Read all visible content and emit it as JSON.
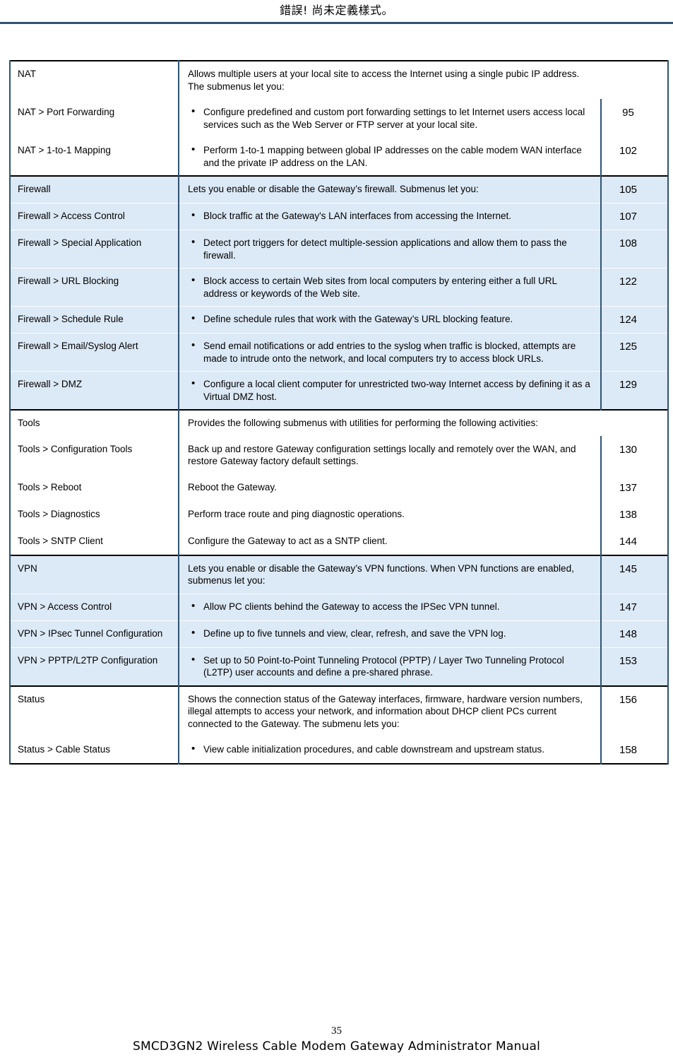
{
  "header": {
    "title": "錯誤! 尚未定義樣式。",
    "rule_color": "#2e5374"
  },
  "footer": {
    "page_number": "35",
    "manual_title": "SMCD3GN2 Wireless Cable Modem Gateway Administrator Manual"
  },
  "table": {
    "shade_color": "#dce9f6",
    "border_color": "#2e5374",
    "sections": [
      {
        "id": "nat",
        "shaded": false,
        "rows": [
          {
            "menu": "NAT",
            "desc": "Allows multiple users at your local site to access the Internet using a single pubic IP address. The submenus let you:",
            "page": "",
            "bullet": false,
            "page_ruled": false
          },
          {
            "menu": "NAT > Port Forwarding",
            "desc": "Configure predefined and custom port forwarding settings to let Internet users access local services such as the Web Server or FTP server at your local site.",
            "page": "95",
            "bullet": true,
            "page_ruled": true
          },
          {
            "menu": "NAT > 1-to-1 Mapping",
            "desc": "Perform 1-to-1 mapping between global IP addresses on the cable modem WAN interface and the private IP address on the LAN.",
            "page": "102",
            "bullet": true,
            "page_ruled": true
          }
        ]
      },
      {
        "id": "firewall",
        "shaded": true,
        "rows": [
          {
            "menu": "Firewall",
            "desc": "Lets you enable or disable the Gateway’s firewall. Submenus let you:",
            "page": "105",
            "bullet": false,
            "page_ruled": true
          },
          {
            "menu": "Firewall > Access Control",
            "desc": "Block traffic at the Gateway's LAN interfaces from accessing the Internet.",
            "page": "107",
            "bullet": true,
            "page_ruled": true
          },
          {
            "menu": "Firewall > Special Application",
            "desc": "Detect port triggers for detect multiple-session applications and allow them to pass the firewall.",
            "page": "108",
            "bullet": true,
            "page_ruled": true
          },
          {
            "menu": "Firewall > URL Blocking",
            "desc": "Block access to certain Web sites from local computers by entering either a full URL address or keywords of the Web site.",
            "page": "122",
            "bullet": true,
            "page_ruled": true
          },
          {
            "menu": "Firewall > Schedule Rule",
            "desc": "Define schedule rules that work with the Gateway’s URL blocking feature.",
            "page": "124",
            "bullet": true,
            "page_ruled": true
          },
          {
            "menu": "Firewall > Email/Syslog Alert",
            "desc": "Send email notifications or add entries to the syslog when traffic is blocked, attempts are made to intrude onto the network, and local computers try to access block URLs.",
            "page": "125",
            "bullet": true,
            "page_ruled": true
          },
          {
            "menu": "Firewall > DMZ",
            "desc": "Configure a local client computer for unrestricted two-way Internet access by defining it as a Virtual DMZ host.",
            "page": "129",
            "bullet": true,
            "page_ruled": true
          }
        ]
      },
      {
        "id": "tools",
        "shaded": false,
        "rows": [
          {
            "menu": "Tools",
            "desc": "Provides the following submenus with utilities for performing the following activities:",
            "page": "",
            "bullet": false,
            "page_ruled": false
          },
          {
            "menu": "Tools > Configuration Tools",
            "desc": "Back up and restore Gateway configuration settings locally and remotely over the WAN, and restore Gateway factory default settings.",
            "page": "130",
            "bullet": false,
            "page_ruled": true
          },
          {
            "menu": "Tools > Reboot",
            "desc": "Reboot the Gateway.",
            "page": "137",
            "bullet": false,
            "page_ruled": true
          },
          {
            "menu": "Tools > Diagnostics",
            "desc": "Perform trace route and ping diagnostic operations.",
            "page": "138",
            "bullet": false,
            "page_ruled": true
          },
          {
            "menu": "Tools > SNTP Client",
            "desc": "Configure the Gateway to act as a SNTP client.",
            "page": "144",
            "bullet": false,
            "page_ruled": true
          }
        ]
      },
      {
        "id": "vpn",
        "shaded": true,
        "rows": [
          {
            "menu": "VPN",
            "desc": "Lets you enable or disable the Gateway’s VPN functions. When VPN functions are enabled, submenus let you:",
            "page": "145",
            "bullet": false,
            "page_ruled": true
          },
          {
            "menu": "VPN > Access Control",
            "desc": "Allow PC clients behind the Gateway to access the IPSec VPN tunnel.",
            "page": "147",
            "bullet": true,
            "page_ruled": true
          },
          {
            "menu": "VPN > IPsec Tunnel Configuration",
            "desc": "Define up to five tunnels and view, clear, refresh, and save the VPN log.",
            "page": "148",
            "bullet": true,
            "page_ruled": true
          },
          {
            "menu": "VPN > PPTP/L2TP Configuration",
            "desc": "Set up to 50 Point-to-Point Tunneling Protocol (PPTP) / Layer Two Tunneling Protocol (L2TP) user accounts and define a pre-shared phrase.",
            "page": "153",
            "bullet": true,
            "page_ruled": true
          }
        ]
      },
      {
        "id": "status",
        "shaded": false,
        "rows": [
          {
            "menu": "Status",
            "desc": "Shows the connection status of the Gateway interfaces, firmware, hardware version numbers, illegal attempts to access your network, and information about DHCP client PCs current connected to the Gateway. The submenu lets you:",
            "page": "156",
            "bullet": false,
            "page_ruled": true
          },
          {
            "menu": "Status > Cable Status",
            "desc": "View cable initialization procedures, and cable downstream and upstream status.",
            "page": "158",
            "bullet": true,
            "page_ruled": true
          }
        ]
      }
    ]
  }
}
